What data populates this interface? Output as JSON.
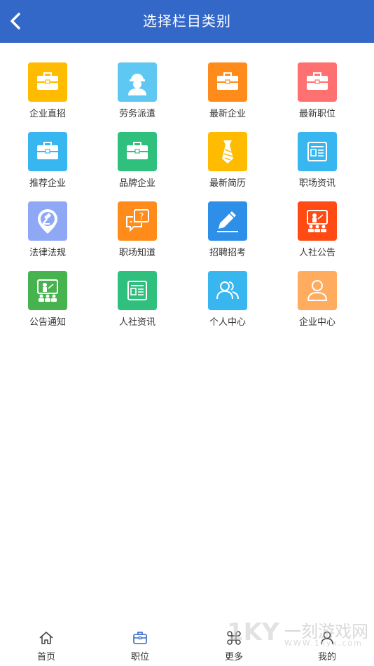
{
  "header": {
    "title": "选择栏目类别",
    "back_icon": "chevron-left-icon",
    "background": "#3468c8"
  },
  "categories": [
    {
      "label": "企业直招",
      "icon": "briefcase-icon",
      "color": "#ffbb00"
    },
    {
      "label": "劳务派遣",
      "icon": "worker-icon",
      "color": "#5ec8f2"
    },
    {
      "label": "最新企业",
      "icon": "briefcase-icon",
      "color": "#ff8c1a"
    },
    {
      "label": "最新职位",
      "icon": "briefcase-icon",
      "color": "#ff7070"
    },
    {
      "label": "推荐企业",
      "icon": "briefcase-icon",
      "color": "#38b6f0"
    },
    {
      "label": "品牌企业",
      "icon": "briefcase-icon",
      "color": "#2fc07e"
    },
    {
      "label": "最新简历",
      "icon": "tie-icon",
      "color": "#ffbb00"
    },
    {
      "label": "职场资讯",
      "icon": "news-icon",
      "color": "#38b6f0"
    },
    {
      "label": "法律法规",
      "icon": "gavel-icon",
      "color": "#8fa8f6"
    },
    {
      "label": "职场知道",
      "icon": "question-chat-icon",
      "color": "#ff8c1a"
    },
    {
      "label": "招聘招考",
      "icon": "pencil-icon",
      "color": "#2d8fe8"
    },
    {
      "label": "人社公告",
      "icon": "presentation-icon",
      "color": "#ff4a14"
    },
    {
      "label": "公告通知",
      "icon": "presentation-icon",
      "color": "#46b34e"
    },
    {
      "label": "人社资讯",
      "icon": "news-icon",
      "color": "#2fc07e"
    },
    {
      "label": "个人中心",
      "icon": "users-icon",
      "color": "#38b6f0"
    },
    {
      "label": "企业中心",
      "icon": "person-icon",
      "color": "#ffac5e"
    }
  ],
  "tabbar": {
    "items": [
      {
        "label": "首页",
        "icon": "home-icon"
      },
      {
        "label": "职位",
        "icon": "briefcase-icon",
        "active": true,
        "color": "#3468c8"
      },
      {
        "label": "更多",
        "icon": "command-icon"
      },
      {
        "label": "我的",
        "icon": "profile-icon"
      }
    ]
  },
  "watermark": {
    "text": "一刻游戏网",
    "url": "WWW.1kyx.com"
  }
}
